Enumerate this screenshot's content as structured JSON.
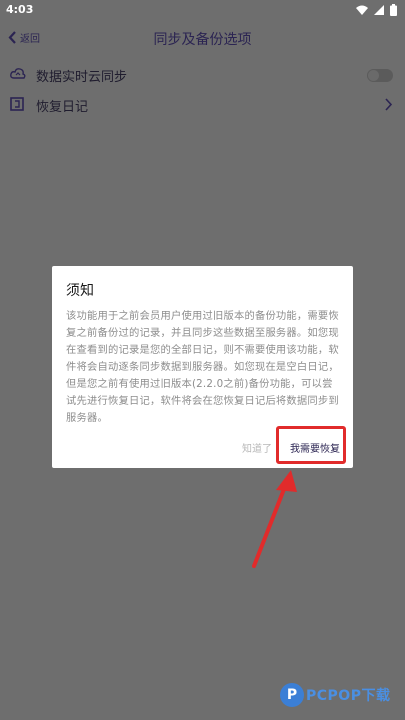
{
  "status_bar": {
    "time": "4:03"
  },
  "app_bar": {
    "back_label": "返回",
    "title": "同步及备份选项"
  },
  "settings": {
    "realtime_sync_label": "数据实时云同步",
    "restore_diary_label": "恢复日记"
  },
  "dialog": {
    "title": "须知",
    "body": "该功能用于之前会员用户使用过旧版本的备份功能，需要恢复之前备份过的记录，并且同步这些数据至服务器。如您现在查看到的记录是您的全部日记，则不需要使用该功能，软件将会自动逐条同步数据到服务器。如您现在是空白日记，但是您之前有使用过旧版本(2.2.0之前)备份功能，可以尝试先进行恢复日记，软件将会在您恢复日记后将数据同步到服务器。",
    "dismiss_label": "知道了",
    "restore_label": "我需要恢复"
  },
  "watermark": {
    "logo_letter": "P",
    "text": "PCPOP下载"
  },
  "colors": {
    "highlight": "#e12b2b",
    "accent": "#2b2452",
    "scrim": "#6e6e6e"
  }
}
